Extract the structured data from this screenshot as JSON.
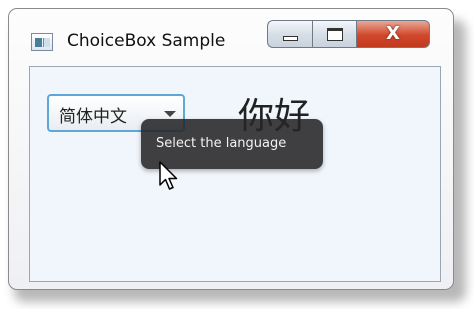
{
  "window": {
    "title": "ChoiceBox Sample",
    "icon": "app-window-icon",
    "caption_buttons": {
      "minimize_icon": "minimize-icon",
      "maximize_icon": "maximize-icon",
      "close_glyph": "X"
    }
  },
  "choicebox": {
    "selected": "简体中文",
    "arrow_icon": "chevron-down-icon",
    "focus_color": "#5fa8d6"
  },
  "greeting": "你好",
  "tooltip": {
    "text": "Select the language"
  },
  "cursor": {
    "icon": "arrow-cursor-icon"
  },
  "colors": {
    "client_background": "#f0f6fc",
    "close_button": "#d1472b",
    "tooltip_background": "#262628"
  }
}
